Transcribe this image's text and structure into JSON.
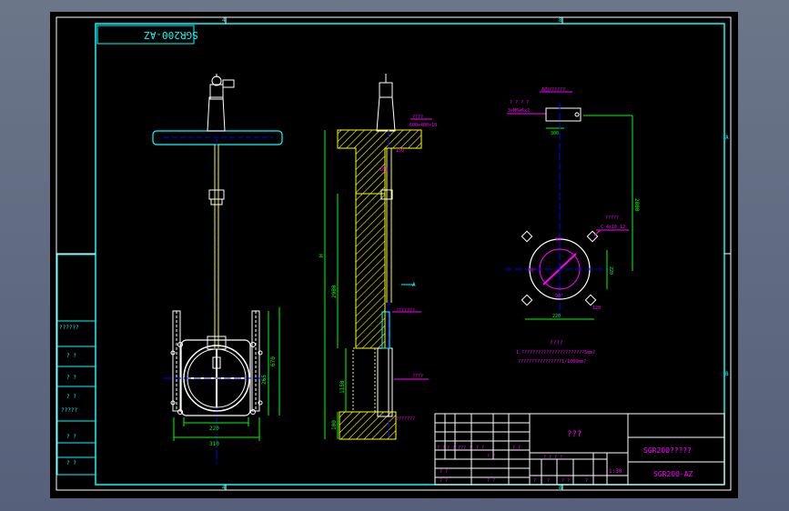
{
  "drawing": {
    "stamp_mirrored": "SGR200-AZ",
    "grid_marks": {
      "top_a": "4",
      "top_b": "8",
      "bottom_a": "4",
      "bottom_b": "8",
      "right_a": "A",
      "right_b": "B"
    },
    "left_panel": [
      "??????",
      "? ?",
      "? ?",
      "? ?",
      "?????",
      "? ?",
      "? ?"
    ],
    "front_view": {
      "dim_width_inner": "220",
      "dim_width_outer": "310",
      "dim_height": "670",
      "dim_side": "265"
    },
    "section_view": {
      "label_top": "????",
      "label_top2": "600×400×10",
      "label_h": "H",
      "label_2980": "2980",
      "label_1150": "1150",
      "label_100": "100",
      "label_mid": "???????",
      "label_low": "????",
      "label_base": "???????",
      "label_arrow": "A",
      "label_small": "150",
      "label_small2": "160"
    },
    "detail_view": {
      "title": "A向??????",
      "label_a": "? ? ? ?",
      "label_b": "3xM6x6x2",
      "dim_top": "300",
      "dim_long": "2800",
      "label_c": "?????",
      "label_d": "C 4x10 12",
      "dim_r": "220",
      "dim_bottom": "220",
      "angle1": "90°",
      "angle2": "90°",
      "angle3": "90°",
      "dim_side": "120"
    },
    "notes": {
      "title": "????",
      "line1": "1.???????????????????????5mm?",
      "line2": "????????????????1/1000mm?"
    },
    "title_block": {
      "center_label": "???",
      "name": "SGR200?????",
      "code": "SGR200-AZ",
      "scale_label": "? ? ? ?",
      "scale_value": "1:30",
      "row_labels": [
        "? ?",
        "? ?",
        "??? ?",
        "? ?",
        "? ?",
        "? ?",
        "? ?",
        "? ?",
        "? ?"
      ],
      "sheet_labels": [
        "?",
        "?",
        "? ?",
        "?"
      ]
    }
  },
  "colors": {
    "frame": "#00ffff",
    "pipe": "#ffff00",
    "dim": "#00ff00",
    "text_magenta": "#ff00ff",
    "white": "#ffffff",
    "blue": "#0000ff",
    "hatch": "#ffff00"
  }
}
